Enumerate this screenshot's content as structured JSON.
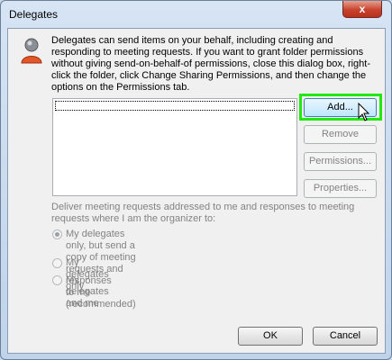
{
  "window": {
    "title": "Delegates",
    "close_glyph": "x"
  },
  "description": "Delegates can send items on your behalf, including creating and responding to meeting requests. If you want to grant folder permissions without giving send-on-behalf-of permissions, close this dialog box, right-click the folder, click Change Sharing Permissions, and then change the options on the Permissions tab.",
  "icon": "user-icon",
  "delegates_list": {
    "items": []
  },
  "buttons": {
    "add": "Add...",
    "remove": "Remove",
    "permissions": "Permissions...",
    "properties": "Properties...",
    "ok": "OK",
    "cancel": "Cancel"
  },
  "meeting_requests": {
    "label": "Deliver meeting requests addressed to me and responses to meeting requests where I am the organizer to:",
    "options": [
      {
        "line1": "My delegates only, but send a copy of meeting requests and responses",
        "line2": "to me (recommended)",
        "selected": true
      },
      {
        "line1": "My delegates only",
        "selected": false
      },
      {
        "line1": "My delegates and me",
        "selected": false
      }
    ]
  },
  "colors": {
    "highlight": "#22e812",
    "close_button": "#c7432e",
    "disabled_text": "#838383"
  }
}
